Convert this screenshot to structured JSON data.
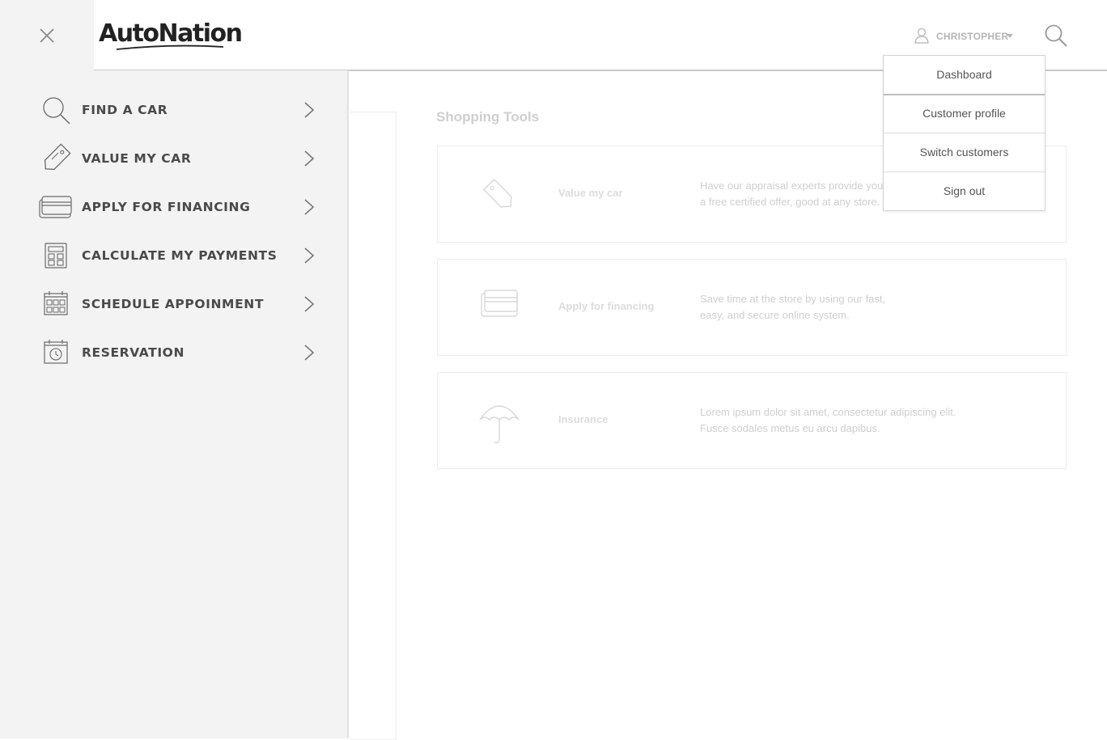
{
  "header": {
    "logo_text": "AutoNation",
    "user_name": "CHRISTOPHER"
  },
  "user_menu": {
    "items": [
      {
        "label": "Dashboard"
      },
      {
        "label": "Customer profile"
      },
      {
        "label": "Switch customers"
      },
      {
        "label": "Sign out"
      }
    ]
  },
  "side_nav": {
    "items": [
      {
        "label": "FIND A CAR",
        "icon": "search-icon"
      },
      {
        "label": "VALUE MY CAR",
        "icon": "price-tag-icon"
      },
      {
        "label": "APPLY FOR FINANCING",
        "icon": "credit-cards-icon"
      },
      {
        "label": "CALCULATE MY PAYMENTS",
        "icon": "calculator-icon"
      },
      {
        "label": "SCHEDULE APPOINMENT",
        "icon": "calendar-icon"
      },
      {
        "label": "RESERVATION",
        "icon": "calendar-clock-icon"
      }
    ]
  },
  "shopping_tools": {
    "title": "Shopping Tools",
    "cards": [
      {
        "name": "Value my car",
        "desc_line1": "Have our appraisal experts provide you",
        "desc_line2": "a free certified offer, good at any store.",
        "icon": "price-tag-icon"
      },
      {
        "name": "Apply for financing",
        "desc_line1": "Save time at the store by using our fast,",
        "desc_line2": "easy, and secure online system.",
        "icon": "credit-cards-icon"
      },
      {
        "name": "Insurance",
        "desc_line1": "Lorem ipsum dolor sit amet, consectetur adipiscing elit.",
        "desc_line2": "Fusce sodales metus eu arcu dapibus.",
        "icon": "umbrella-icon"
      }
    ]
  },
  "colors": {
    "nav_background": "#f3f3f3",
    "nav_text": "#4a4a4a",
    "faded_text": "#cfcfcf"
  }
}
